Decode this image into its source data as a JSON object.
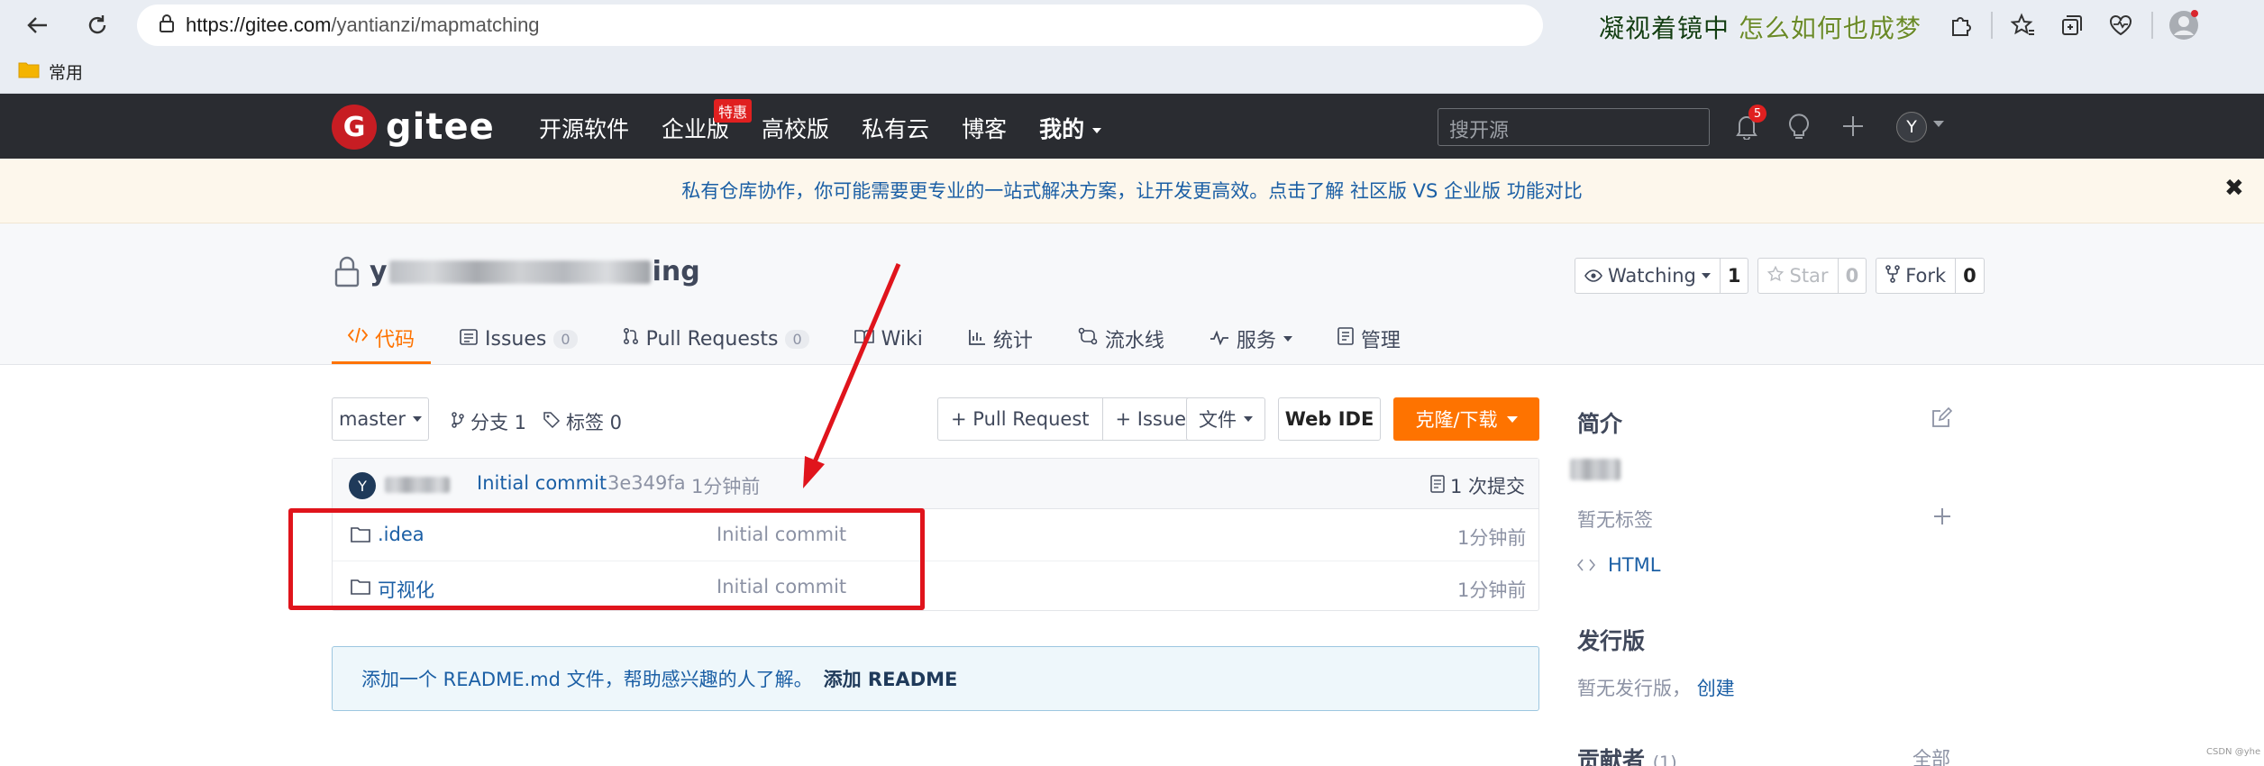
{
  "browser": {
    "url_host": "https://gitee.com",
    "url_path": "/yantianzi/mapmatching",
    "overlay_text_main": "凝视着镜中",
    "overlay_text_faded": "怎么如何也成梦",
    "bookmark_folder": "常用",
    "icons": [
      "back-arrow-icon",
      "refresh-icon",
      "lock-icon",
      "puzzle-icon",
      "favorites-star-icon",
      "collections-icon",
      "heart-pulse-icon",
      "profile-icon"
    ]
  },
  "header": {
    "logo_text": "gitee",
    "logo_letter": "G",
    "nav": [
      "开源软件",
      "企业版",
      "高校版",
      "私有云",
      "博客",
      "我的"
    ],
    "hot_badge": "特惠",
    "search_placeholder": "搜开源",
    "notification_count": "5",
    "avatar_letter": "Y",
    "colors": {
      "bg": "#2a2c31",
      "brand": "#c71d23",
      "accent": "#fe7300"
    }
  },
  "banner": {
    "text": "私有仓库协作，你可能需要更专业的一站式解决方案，让开发更高效。点击了解 社区版 VS 企业版 功能对比",
    "close": "✖"
  },
  "repo": {
    "name_prefix": "y",
    "name_suffix": "ing",
    "watching_label": "Watching",
    "watching_count": "1",
    "star_label": "Star",
    "star_count": "0",
    "fork_label": "Fork",
    "fork_count": "0",
    "tabs": [
      {
        "label": "代码",
        "icon": "code-icon"
      },
      {
        "label": "Issues",
        "count": "0",
        "icon": "issues-icon"
      },
      {
        "label": "Pull Requests",
        "count": "0",
        "icon": "pull-request-icon"
      },
      {
        "label": "Wiki",
        "icon": "book-icon"
      },
      {
        "label": "统计",
        "icon": "bar-chart-icon"
      },
      {
        "label": "流水线",
        "icon": "pipeline-icon"
      },
      {
        "label": "服务",
        "icon": "pulse-icon"
      },
      {
        "label": "管理",
        "icon": "manage-icon"
      }
    ]
  },
  "toolbar": {
    "branch": "master",
    "branches": "分支 1",
    "tags": "标签 0",
    "pull_request": "+ Pull Request",
    "issue": "+ Issue",
    "file": "文件",
    "web_ide": "Web IDE",
    "clone": "克隆/下载"
  },
  "commit": {
    "avatar": "Y",
    "message": "Initial commit",
    "hash": "3e349fa",
    "time": "1分钟前",
    "count": "1 次提交"
  },
  "files": [
    {
      "name": ".idea",
      "message": "Initial commit",
      "time": "1分钟前"
    },
    {
      "name": "可视化",
      "message": "Initial commit",
      "time": "1分钟前"
    }
  ],
  "readme": {
    "text": "添加一个 README.md 文件，帮助感兴趣的人了解。",
    "link": "添加 README"
  },
  "sidebar": {
    "intro_title": "简介",
    "no_tags": "暂无标签",
    "language": "HTML",
    "release_title": "发行版",
    "no_release": "暂无发行版，",
    "create": "创建",
    "contributors_title": "贡献者",
    "contributors_count": "(1)",
    "all": "全部"
  },
  "watermark": "CSDN @yhe"
}
